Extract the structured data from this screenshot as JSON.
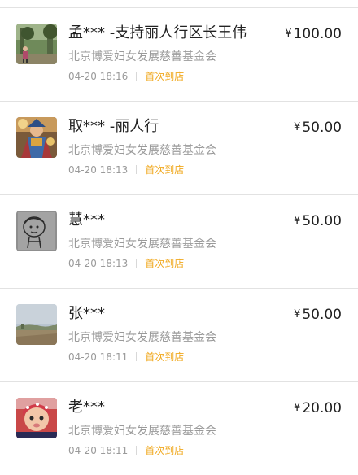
{
  "currency_symbol": "¥",
  "donations": [
    {
      "name": "孟*** -支持丽人行区长王伟",
      "amount": "100.00",
      "org": "北京博爱妇女发展慈善基金会",
      "time": "04-20 18:16",
      "tag": "首次到店",
      "avatar_icon": "avatar-photo-outdoor-person-icon"
    },
    {
      "name": "取*** -丽人行",
      "amount": "50.00",
      "org": "北京博爱妇女发展慈善基金会",
      "time": "04-20 18:13",
      "tag": "首次到店",
      "avatar_icon": "avatar-photo-costume-icon"
    },
    {
      "name": "慧***",
      "amount": "50.00",
      "org": "北京博爱妇女发展慈善基金会",
      "time": "04-20 18:13",
      "tag": "首次到店",
      "avatar_icon": "avatar-cartoon-sketch-icon"
    },
    {
      "name": "张***",
      "amount": "50.00",
      "org": "北京博爱妇女发展慈善基金会",
      "time": "04-20 18:11",
      "tag": "首次到店",
      "avatar_icon": "avatar-landscape-icon"
    },
    {
      "name": "老***",
      "amount": "20.00",
      "org": "北京博爱妇女发展慈善基金会",
      "time": "04-20 18:11",
      "tag": "首次到店",
      "avatar_icon": "avatar-photo-baby-icon"
    }
  ],
  "colors": {
    "tag": "#f0a81e",
    "secondary_text": "#9a9a9a",
    "primary_text": "#222222",
    "divider": "#e2e2e2"
  }
}
